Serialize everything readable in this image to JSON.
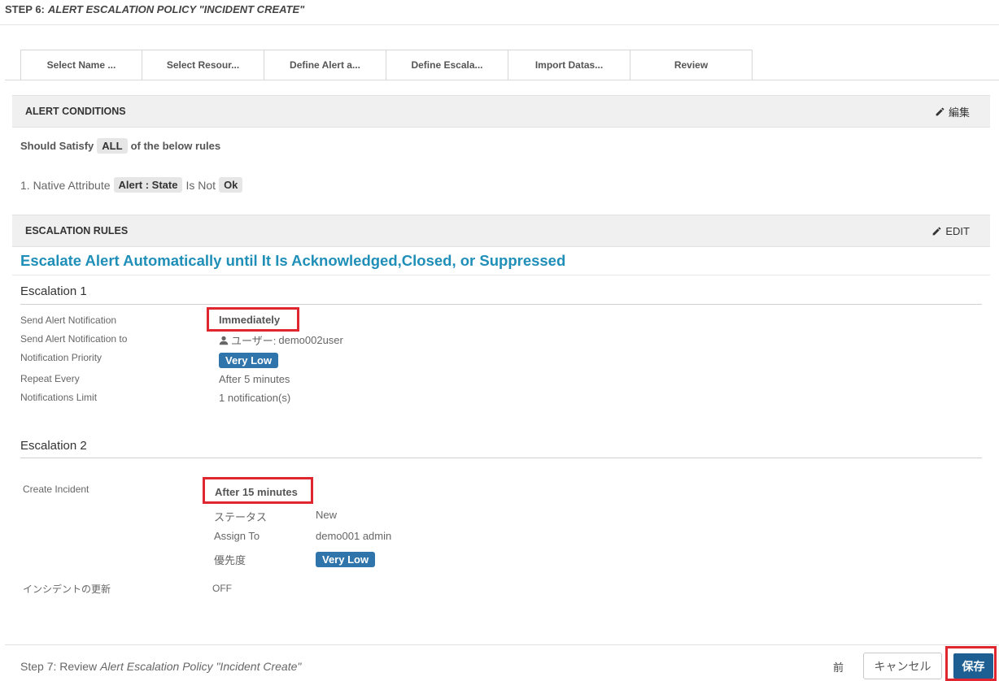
{
  "header": {
    "step_label": "STEP 6:",
    "step_title": "ALERT ESCALATION POLICY \"INCIDENT CREATE\""
  },
  "tabs": [
    {
      "label": "Select Name ..."
    },
    {
      "label": "Select Resour..."
    },
    {
      "label": "Define Alert a..."
    },
    {
      "label": "Define Escala..."
    },
    {
      "label": "Import Datas..."
    },
    {
      "label": "Review"
    }
  ],
  "alert_conditions": {
    "title": "ALERT CONDITIONS",
    "edit_label": "編集",
    "satisfy_prefix": "Should Satisfy",
    "satisfy_value": "ALL",
    "satisfy_suffix": "of the below rules",
    "rule": {
      "prefix": "1. Native Attribute",
      "attribute": "Alert : State",
      "operator": "Is Not",
      "value": "Ok"
    }
  },
  "escalation_rules": {
    "title": "ESCALATION RULES",
    "edit_label": "EDIT",
    "heading": "Escalate Alert Automatically until It Is Acknowledged,Closed, or Suppressed"
  },
  "escalation1": {
    "title": "Escalation 1",
    "send_label": "Send Alert Notification",
    "send_value": "Immediately",
    "send_to_label": "Send Alert Notification to",
    "send_to_prefix": "ユーザー:",
    "send_to_value": "demo002user",
    "priority_label": "Notification Priority",
    "priority_value": "Very Low",
    "repeat_label": "Repeat Every",
    "repeat_value": "After 5 minutes",
    "limit_label": "Notifications Limit",
    "limit_value": "1 notification(s)"
  },
  "escalation2": {
    "title": "Escalation 2",
    "create_label": "Create Incident",
    "create_value": "After 15 minutes",
    "status_label": "ステータス",
    "status_value": "New",
    "assign_label": "Assign To",
    "assign_value": "demo001 admin",
    "priority_label": "優先度",
    "priority_value": "Very Low",
    "update_label": "インシデントの更新",
    "update_value": "OFF"
  },
  "footer": {
    "step7_prefix": "Step 7: Review",
    "step7_title": "Alert Escalation Policy \"Incident Create\"",
    "prev_label": "前",
    "cancel_label": "キャンセル",
    "save_label": "保存"
  },
  "colors": {
    "accent": "#1f8fb8",
    "priority_badge": "#2f74ab",
    "save_button": "#1d5e93",
    "highlight_box": "#e0262e"
  },
  "icons": {
    "edit": "pencil-icon",
    "user": "user-icon"
  }
}
